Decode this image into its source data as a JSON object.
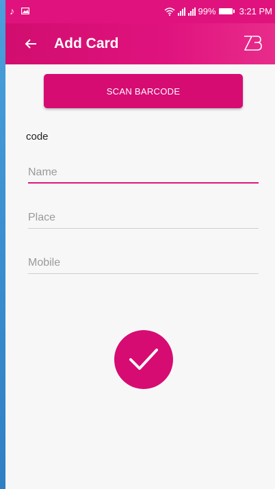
{
  "status_bar": {
    "battery": "99%",
    "time": "3:21 PM",
    "icons": [
      "music-note-icon",
      "image-icon",
      "wifi-icon",
      "signal-icon",
      "signal-icon",
      "battery-icon"
    ]
  },
  "toolbar": {
    "title": "Add Card",
    "back_icon": "arrow-left-icon",
    "logo_text": "ZB"
  },
  "scan_button": {
    "label": "SCAN BARCODE"
  },
  "code_label": "code",
  "form": {
    "name": {
      "placeholder": "Name",
      "value": ""
    },
    "place": {
      "placeholder": "Place",
      "value": ""
    },
    "mobile": {
      "placeholder": "Mobile",
      "value": ""
    }
  },
  "submit": {
    "icon": "checkmark-icon"
  },
  "colors": {
    "accent": "#e0137e",
    "button": "#d60c73",
    "background": "#f7f7f7",
    "outer_background": "#3b8fd0"
  }
}
